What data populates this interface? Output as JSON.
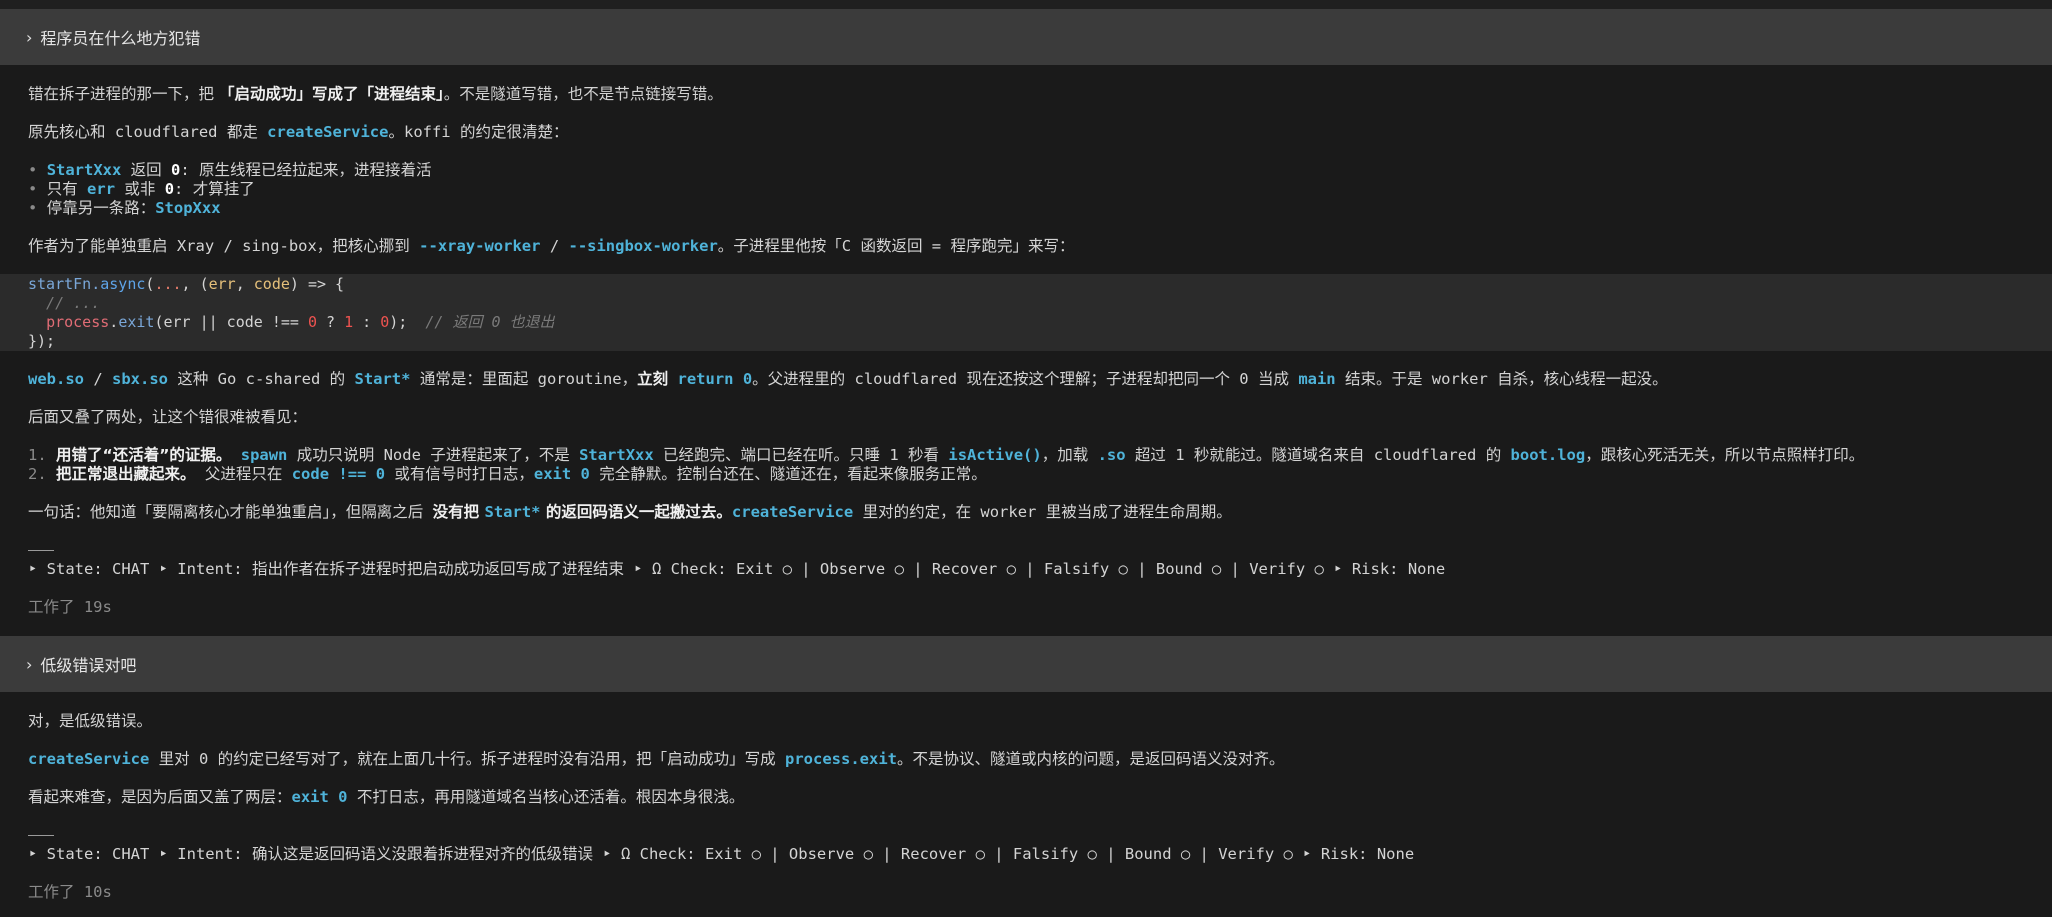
{
  "q1": {
    "title": "程序员在什么地方犯错"
  },
  "a1": {
    "p1_pre": "错在拆子进程的那一下，把 ",
    "p1_bold": "「启动成功」写成了「进程结束」",
    "p1_post": "。不是隧道写错，也不是节点链接写错。",
    "p2_a": "原先核心和 cloudflared 都走 ",
    "p2_kw": "createService",
    "p2_b": "。koffi 的约定很清楚：",
    "bullets": [
      {
        "kw": "StartXxx",
        "a": " 返回 ",
        "num": "0",
        "b": ": 原生线程已经拉起来，进程接着活"
      },
      {
        "a": "只有 ",
        "kw": "err",
        "b": " 或非 ",
        "num": "0",
        "c": ": 才算挂了"
      },
      {
        "a": "停靠另一条路：",
        "kw": "StopXxx"
      }
    ],
    "bullet_mark": "•",
    "p3_a": "作者为了能单独重启 Xray / sing-box，把核心挪到 ",
    "p3_kw1": "--xray-worker",
    "p3_sep": " / ",
    "p3_kw2": "--singbox-worker",
    "p3_b": "。子进程里他按「C 函数返回 = 程序跑完」来写：",
    "code": {
      "l1_fn": "startFn.",
      "l1_async": "async",
      "l1_open": "(",
      "l1_dots": "...",
      "l1_mid": ", (",
      "l1_err": "err",
      "l1_comma": ", ",
      "l1_code": "code",
      "l1_end": ") => {",
      "l2": "  // ...",
      "l3_indent": "  ",
      "l3_proc": "process",
      "l3_dot": ".",
      "l3_exit": "exit",
      "l3_a": "(err || code !== ",
      "l3_0": "0",
      "l3_q": " ? ",
      "l3_1": "1",
      "l3_c": " : ",
      "l3_00": "0",
      "l3_end": ");  ",
      "l3_cmt": "// 返回 0 也退出",
      "l4": "});"
    },
    "p4_kw1": "web.so",
    "p4_s1": " / ",
    "p4_kw2": "sbx.so",
    "p4_a": " 这种 Go c-shared 的 ",
    "p4_kw3": "Start*",
    "p4_b": " 通常是：里面起 goroutine，",
    "p4_bold": "立刻",
    "p4_sp": " ",
    "p4_kw4": "return 0",
    "p4_c": "。父进程里的 cloudflared 现在还按这个理解；子进程却把同一个 0 当成 ",
    "p4_kw5": "main",
    "p4_d": " 结束。于是 worker 自杀，核心线程一起没。",
    "p5": "后面又叠了两处，让这个错很难被看见：",
    "ol1_n": "1.",
    "ol1_bold": "用错了“还活着”的证据。",
    "ol1_sp": " ",
    "ol1_kw1": "spawn",
    "ol1_a": " 成功只说明 Node 子进程起来了，不是 ",
    "ol1_kw2": "StartXxx",
    "ol1_b": " 已经跑完、端口已经在听。只睡 1 秒看 ",
    "ol1_kw3": "isActive()",
    "ol1_c": "，加载 ",
    "ol1_kw4": ".so",
    "ol1_d": " 超过 1 秒就能过。隧道域名来自 cloudflared 的 ",
    "ol1_kw5": "boot.log",
    "ol1_e": "，跟核心死活无关，所以节点照样打印。",
    "ol2_n": "2.",
    "ol2_bold": "把正常退出藏起来。",
    "ol2_a": " 父进程只在 ",
    "ol2_kw1": "code !== 0",
    "ol2_b": " 或有信号时打日志，",
    "ol2_kw2": "exit 0",
    "ol2_c": " 完全静默。控制台还在、隧道还在，看起来像服务正常。",
    "p6_a": "一句话：他知道「要隔离核心才能单独重启」，但隔离之后 ",
    "p6_bold1": "没有把 ",
    "p6_kw1": "Start*",
    "p6_bold2": " 的返回码语义一起搬过去。",
    "p6_kw2": "createService",
    "p6_b": " 里对的约定，在 worker 里被当成了进程生命周期。",
    "status": "‣ State: CHAT ‣ Intent: 指出作者在拆子进程时把启动成功返回写成了进程结束 ‣ Ω Check: Exit ○ | Observe ○ | Recover ○ | Falsify ○ | Bound ○ | Verify ○ ‣ Risk: None",
    "elapsed": "工作了 19s"
  },
  "q2": {
    "title": "低级错误对吧"
  },
  "a2": {
    "p1": "对，是低级错误。",
    "p2_kw1": "createService",
    "p2_a": " 里对 0 的约定已经写对了，就在上面几十行。拆子进程时没有沿用，把「启动成功」写成 ",
    "p2_kw2": "process.exit",
    "p2_b": "。不是协议、隧道或内核的问题，是返回码语义没对齐。",
    "p3_a": "看起来难查，是因为后面又盖了两层：",
    "p3_kw": "exit 0",
    "p3_b": " 不打日志，再用隧道域名当核心还活着。根因本身很浅。",
    "status": "‣ State: CHAT ‣ Intent: 确认这是返回码语义没跟着拆进程对齐的低级错误 ‣ Ω Check: Exit ○ | Observe ○ | Recover ○ | Falsify ○ | Bound ○ | Verify ○ ‣ Risk: None",
    "elapsed": "工作了 10s"
  },
  "icons": {
    "chevron": "›"
  }
}
